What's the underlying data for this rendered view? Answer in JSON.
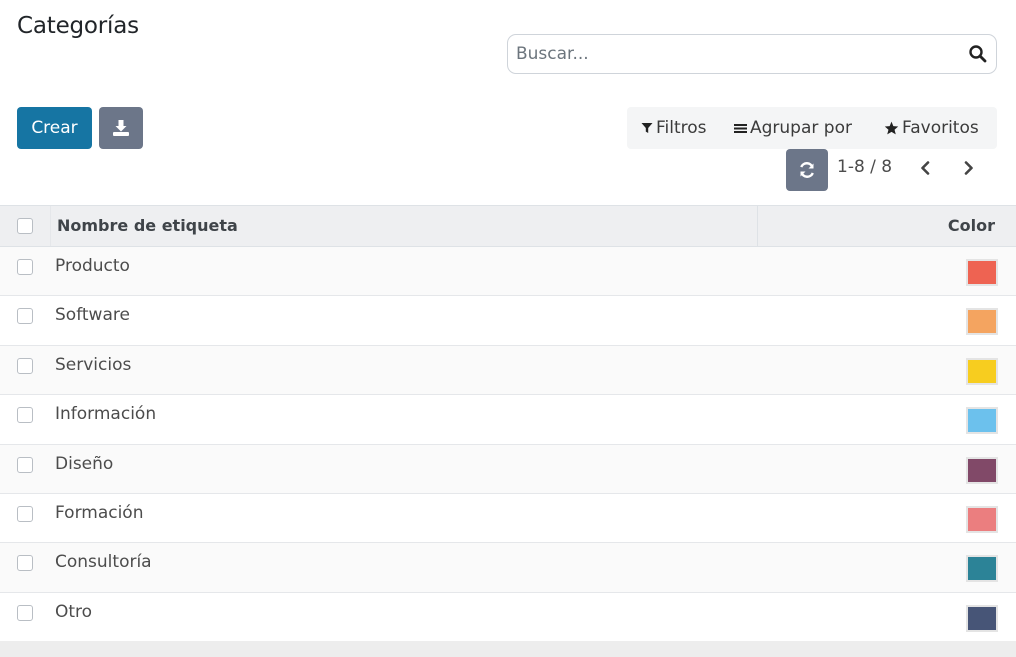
{
  "page": {
    "title": "Categorías"
  },
  "search": {
    "placeholder": "Buscar..."
  },
  "toolbar": {
    "create_label": "Crear"
  },
  "filters": {
    "filters_label": "Filtros",
    "group_by_label": "Agrupar por",
    "favorites_label": "Favoritos"
  },
  "pager": {
    "value": "1-8 / 8"
  },
  "table": {
    "columns": [
      "Nombre de etiqueta",
      "Color"
    ],
    "rows": [
      {
        "name": "Producto",
        "color": "#ee6352"
      },
      {
        "name": "Software",
        "color": "#f4a460"
      },
      {
        "name": "Servicios",
        "color": "#f7cd1f"
      },
      {
        "name": "Información",
        "color": "#6cc1ed"
      },
      {
        "name": "Diseño",
        "color": "#814968"
      },
      {
        "name": "Formación",
        "color": "#eb7e7f"
      },
      {
        "name": "Consultoría",
        "color": "#2c8397"
      },
      {
        "name": "Otro",
        "color": "#475577"
      }
    ]
  }
}
